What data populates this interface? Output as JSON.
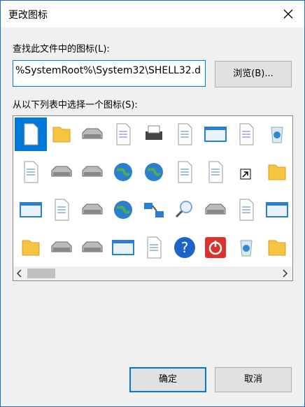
{
  "window": {
    "title": "更改图标"
  },
  "find_label": "查找此文件中的图标(L):",
  "path_value": "%SystemRoot%\\System32\\SHELL32.d",
  "browse_label": "浏览(B)...",
  "list_label": "从以下列表中选择一个图标(S):",
  "icons": [
    "blank-file-icon",
    "folder-icon",
    "drive-icon",
    "chip-icon",
    "printer-icon",
    "clock-document-icon",
    "window-glow-icon",
    "hand-icon",
    "recycle-bin-icon",
    "text-document-icon",
    "server-icon",
    "network-drive-icon",
    "globe-icon",
    "network-globe-icon",
    "control-panel-icon",
    "speaker-icon",
    "shortcut-arrow-icon",
    "folder-settings-icon",
    "window-icon",
    "floppy-icon",
    "drive-disconnected-icon",
    "globe-mouse-icon",
    "network-icon",
    "magnifier-icon",
    "drive-arrow-icon",
    "power-clock-icon",
    "blue-window-icon",
    "folder-open-icon",
    "disk-drive-icon",
    "cd-drive-icon",
    "monitor-icon",
    "document-grid-icon",
    "help-icon",
    "power-icon",
    "recycle-bin-full-icon",
    "folder-network-icon"
  ],
  "buttons": {
    "ok": "确定",
    "cancel": "取消"
  }
}
